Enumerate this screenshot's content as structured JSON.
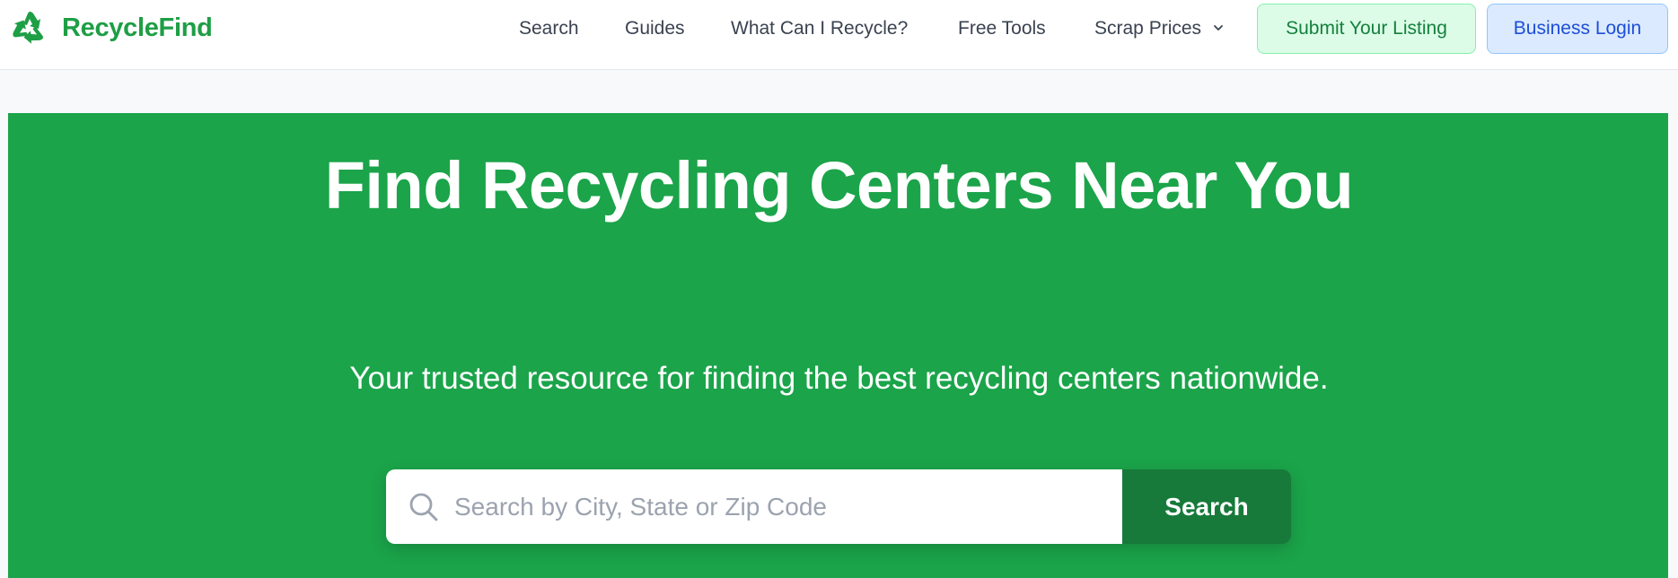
{
  "brand": {
    "name": "RecycleFind",
    "logo_icon": "recycle-icon",
    "color": "#1e9e45"
  },
  "nav": {
    "search": "Search",
    "guides": "Guides",
    "what_can_i_recycle": "What Can I Recycle?",
    "free_tools": "Free Tools",
    "scrap_prices": "Scrap Prices",
    "scrap_prices_icon": "chevron-down-icon"
  },
  "actions": {
    "submit_listing": "Submit Your Listing",
    "business_login": "Business Login"
  },
  "hero": {
    "title": "Find Recycling Centers Near You",
    "subtitle": "Your trusted resource for finding the best recycling centers nationwide.",
    "background_color": "#1ba44a"
  },
  "search": {
    "placeholder": "Search by City, State or Zip Code",
    "value": "",
    "icon": "search-icon",
    "button_label": "Search",
    "button_color": "#177a3a"
  }
}
